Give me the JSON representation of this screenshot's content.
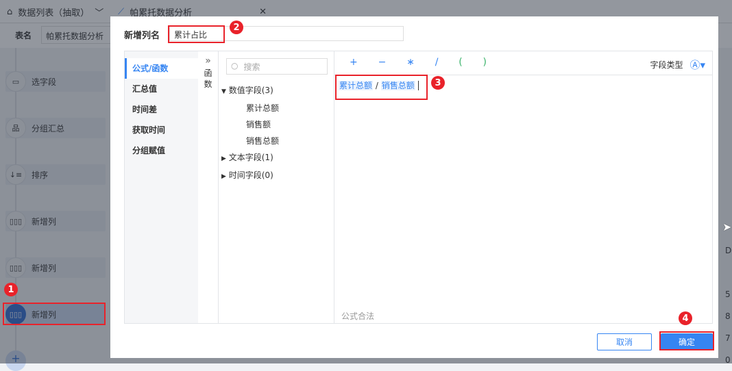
{
  "background": {
    "tabs": [
      {
        "label": "数据列表（抽取）",
        "icon": "home-icon"
      },
      {
        "label": "帕累托数据分析",
        "icon": "chart-line-icon"
      }
    ],
    "table_name_label": "表名",
    "table_name_value": "帕累托数据分析",
    "steps": [
      {
        "label": "选字段",
        "icon": "select-field-icon"
      },
      {
        "label": "分组汇总",
        "icon": "group-icon"
      },
      {
        "label": "排序",
        "icon": "sort-icon"
      },
      {
        "label": "新增列",
        "icon": "column-icon"
      },
      {
        "label": "新增列",
        "icon": "column-icon"
      },
      {
        "label": "新增列",
        "icon": "column-icon"
      }
    ],
    "add_label": "+",
    "right_cells": [
      "DC",
      "5",
      "8",
      "7",
      "0"
    ]
  },
  "dialog": {
    "name_label": "新增列名",
    "name_value": "累计占比",
    "nav": [
      "公式/函数",
      "汇总值",
      "时间差",
      "获取时间",
      "分组赋值"
    ],
    "func_toggle": "函数",
    "search_placeholder": "搜索",
    "groups": [
      {
        "label": "数值字段(3)",
        "expanded": true,
        "items": [
          "累计总额",
          "销售额",
          "销售总额"
        ]
      },
      {
        "label": "文本字段(1)",
        "expanded": false
      },
      {
        "label": "时间字段(0)",
        "expanded": false
      }
    ],
    "operators": [
      "+",
      "−",
      "∗",
      "/",
      "(",
      ")"
    ],
    "field_type_label": "字段类型",
    "formula": {
      "left": "累计总额",
      "op": "/",
      "right": "销售总额"
    },
    "status": "公式合法",
    "cancel": "取消",
    "confirm": "确定"
  },
  "annotations": [
    "1",
    "2",
    "3",
    "4"
  ],
  "colors": {
    "accent": "#3685f2",
    "annotation": "#e9222a"
  }
}
